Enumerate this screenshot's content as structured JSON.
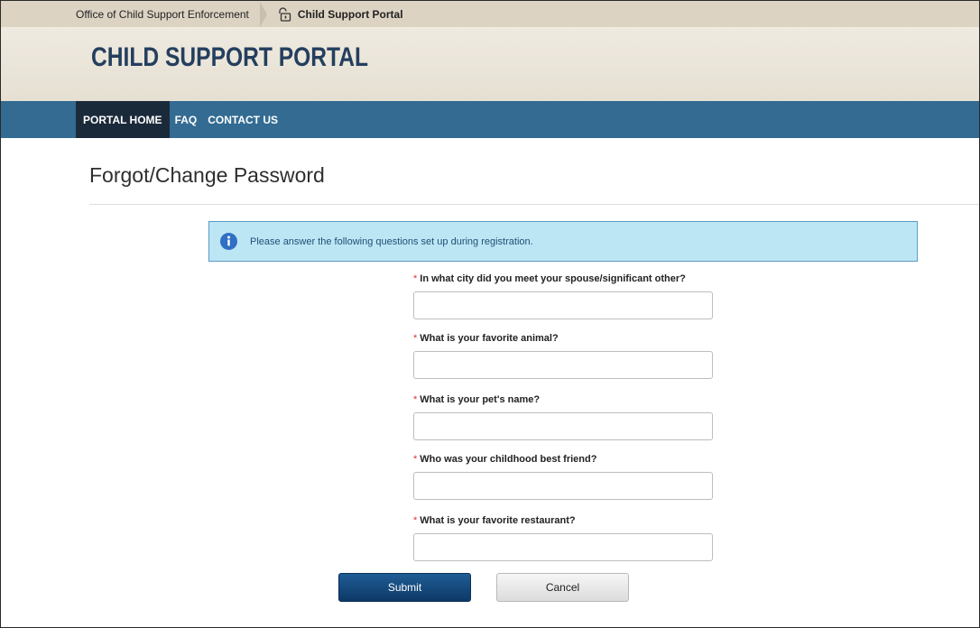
{
  "breadcrumb": {
    "home": "Office of Child Support Enforcement",
    "current": "Child Support Portal"
  },
  "header": {
    "title": "CHILD SUPPORT PORTAL"
  },
  "nav": {
    "items": [
      {
        "label": "PORTAL HOME",
        "active": true
      },
      {
        "label": "FAQ"
      },
      {
        "label": "CONTACT US"
      }
    ]
  },
  "page": {
    "title": "Forgot/Change Password"
  },
  "alert": {
    "text": "Please answer the following questions set up during registration."
  },
  "form": {
    "required_mark": "*",
    "questions": [
      {
        "label": "In what city did you meet your spouse/significant other?",
        "value": ""
      },
      {
        "label": "What is your favorite animal?",
        "value": ""
      },
      {
        "label": "What is your pet's name?",
        "value": ""
      },
      {
        "label": "Who was your childhood best friend?",
        "value": ""
      },
      {
        "label": "What is your favorite restaurant?",
        "value": ""
      }
    ],
    "submit_label": "Submit",
    "cancel_label": "Cancel"
  },
  "colors": {
    "nav_bg": "#336b92",
    "nav_active_bg": "#1b2a3a",
    "title_color": "#243f5e",
    "alert_bg": "#bde6f5",
    "submit_bg": "#0d3866"
  },
  "icons": {
    "lock": "lock-icon",
    "info": "info-icon"
  }
}
